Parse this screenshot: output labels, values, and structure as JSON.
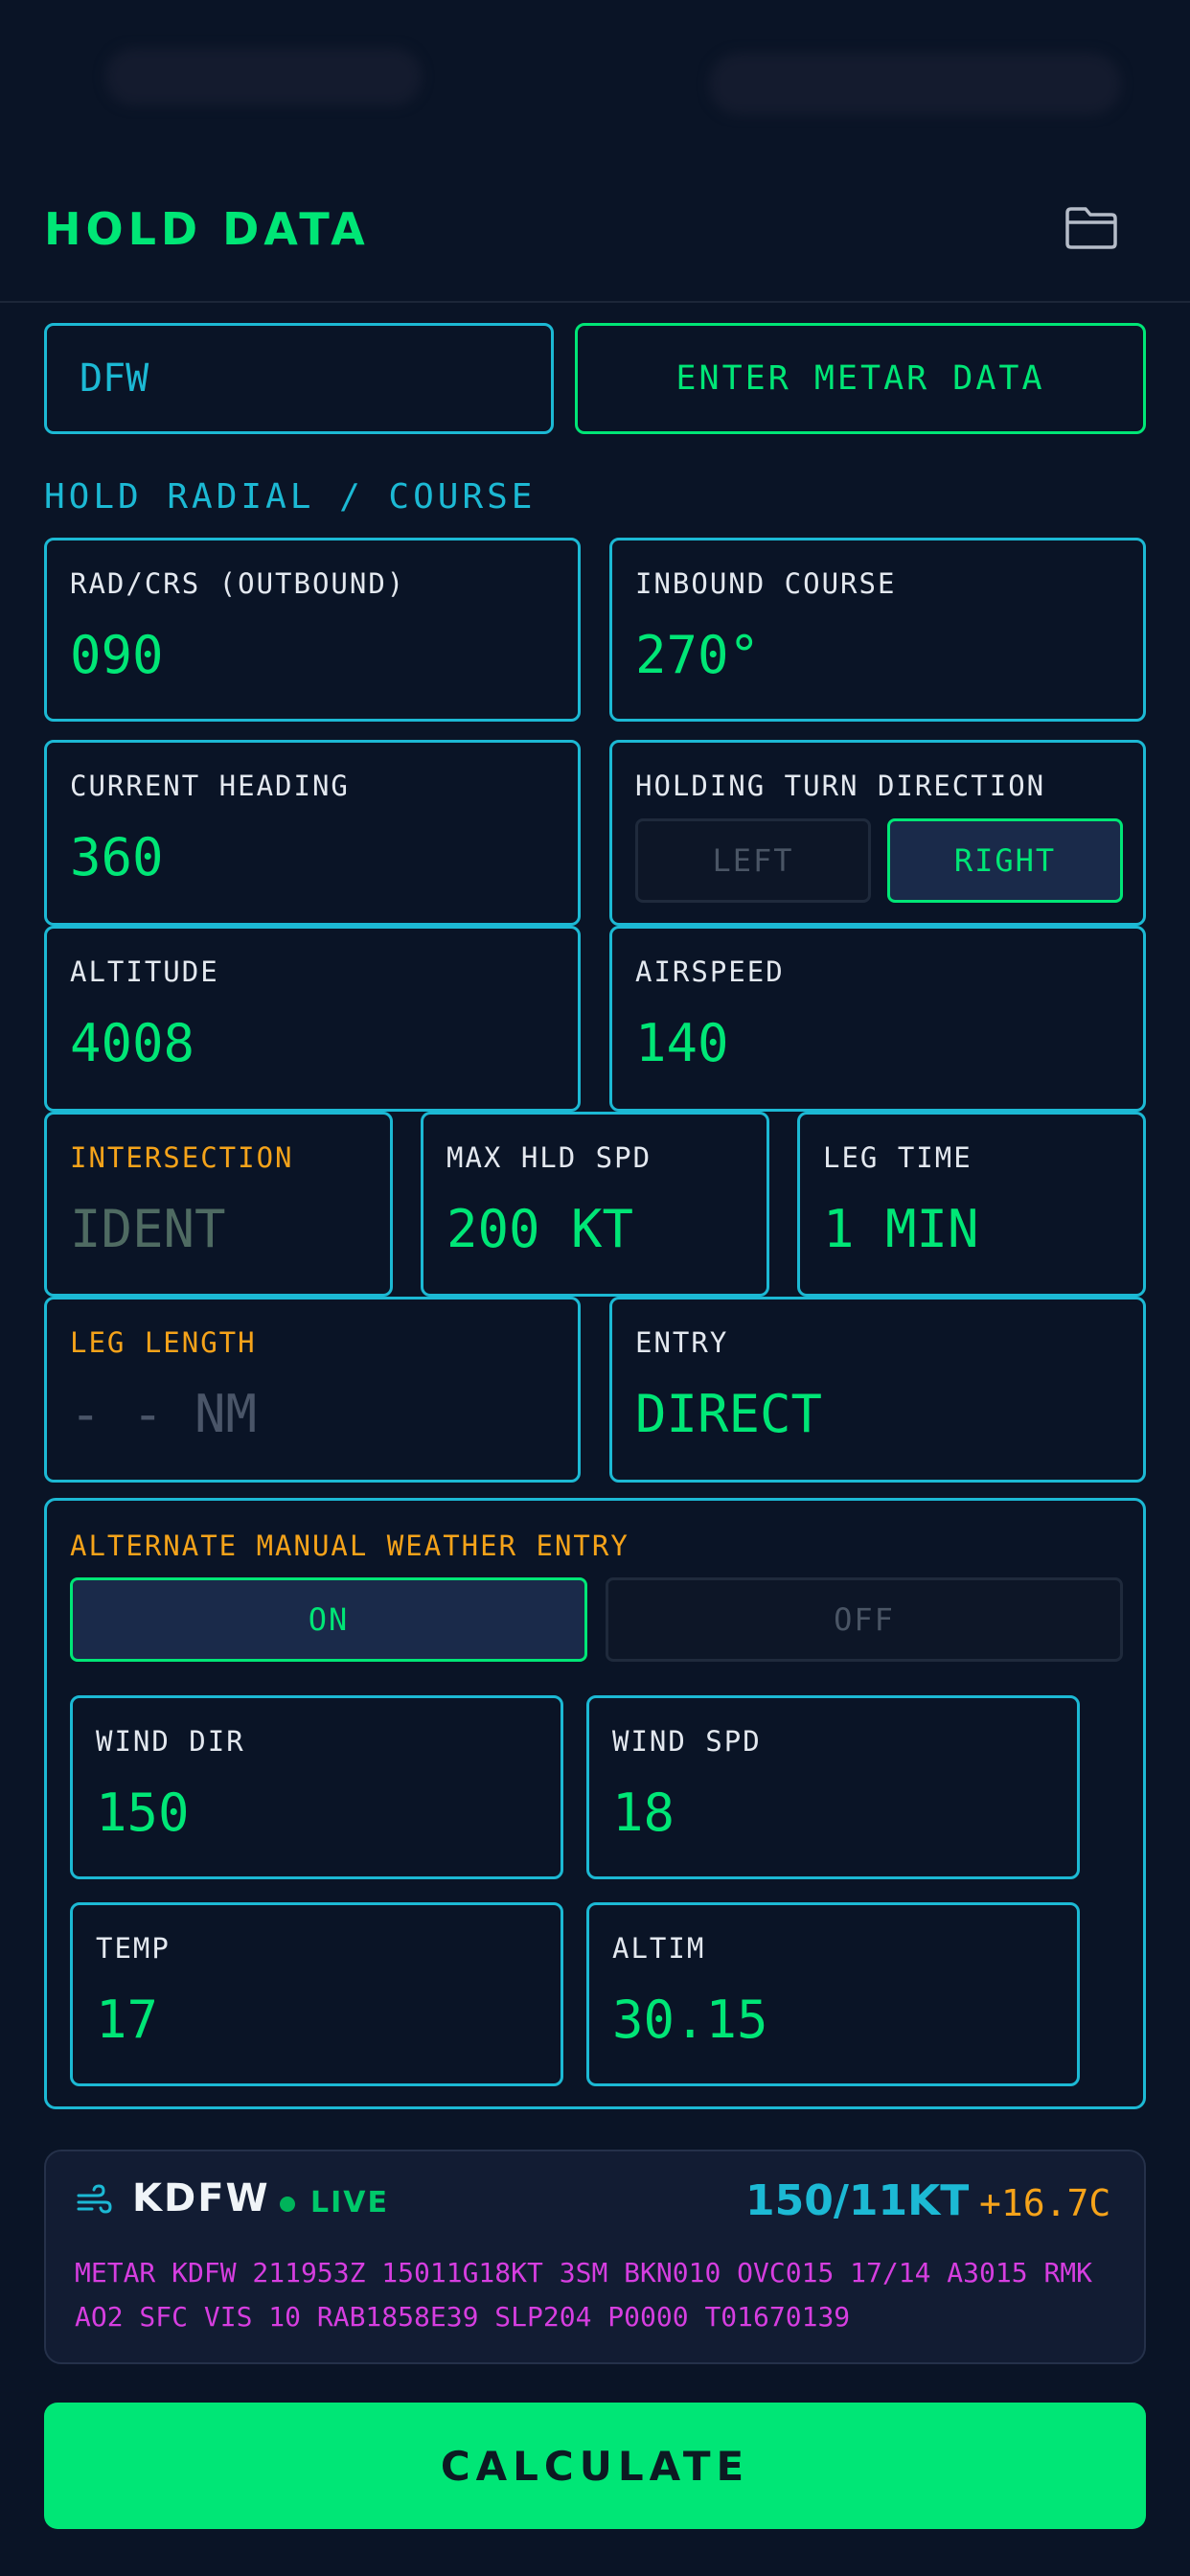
{
  "header": {
    "title": "HOLD DATA",
    "folder_icon": "folder-icon"
  },
  "top_row": {
    "ident_value": "DFW",
    "metar_button": "ENTER METAR DATA"
  },
  "section_title": "HOLD RADIAL / COURSE",
  "fields": {
    "radial": {
      "label": "RAD/CRS (OUTBOUND)",
      "value": "090"
    },
    "inbound": {
      "label": "INBOUND COURSE",
      "value": "270°"
    },
    "heading": {
      "label": "CURRENT HEADING",
      "value": "360"
    },
    "turn": {
      "label": "HOLDING TURN DIRECTION",
      "left": "LEFT",
      "right": "RIGHT",
      "selected": "RIGHT"
    },
    "altitude": {
      "label": "ALTITUDE",
      "value": "4008"
    },
    "airspeed": {
      "label": "AIRSPEED",
      "value": "140"
    },
    "intersection": {
      "label": "INTERSECTION",
      "placeholder": "IDENT"
    },
    "max_hold_speed": {
      "label": "MAX HLD SPD",
      "value": "200 KT"
    },
    "leg_time": {
      "label": "LEG TIME",
      "value": "1 MIN"
    },
    "leg_length": {
      "label": "LEG LENGTH",
      "value": "- - NM"
    },
    "entry": {
      "label": "ENTRY",
      "value": "DIRECT"
    }
  },
  "weather": {
    "title": "ALTERNATE MANUAL WEATHER ENTRY",
    "on": "ON",
    "off": "OFF",
    "selected": "ON",
    "wind_dir": {
      "label": "WIND DIR",
      "value": "150"
    },
    "wind_spd": {
      "label": "WIND SPD",
      "value": "18"
    },
    "temp": {
      "label": "TEMP",
      "value": "17"
    },
    "altim": {
      "label": "ALTIM",
      "value": "30.15"
    }
  },
  "metar": {
    "station": "KDFW",
    "live": "LIVE",
    "wind": "150/11KT",
    "temp": "+16.7C",
    "raw": "METAR KDFW 211953Z 15011G18KT 3SM BKN010 OVC015 17/14 A3015 RMK AO2 SFC VIS 10 RAB1858E39 SLP204 P0000 T01670139",
    "icon": "wind-icon"
  },
  "calculate": "CALCULATE",
  "colors": {
    "background": "#0a1426",
    "accent_green": "#00e676",
    "accent_cyan": "#1cb9d4",
    "accent_amber": "#f5a31a",
    "metar_magenta": "#d63ee0"
  }
}
